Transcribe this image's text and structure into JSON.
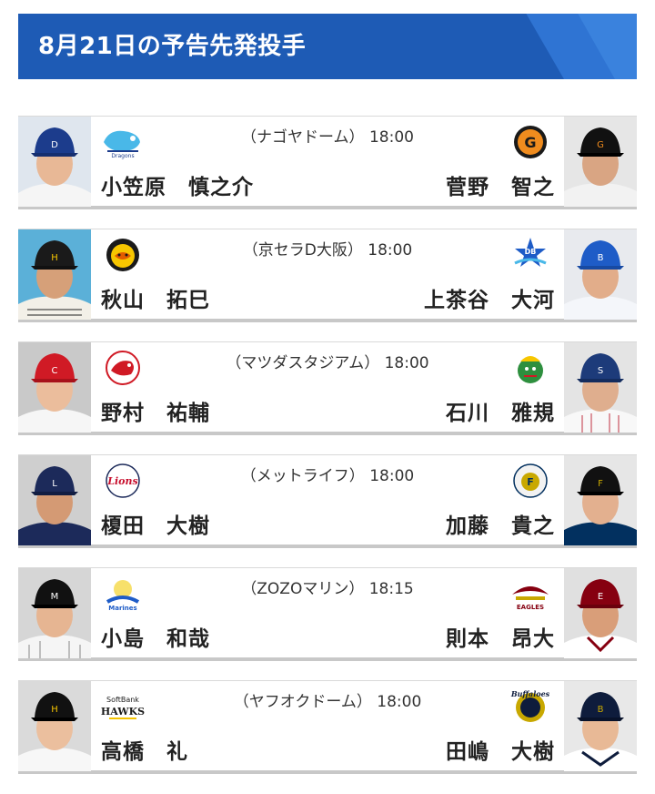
{
  "page_title": "8月21日の予告先発投手",
  "games": [
    {
      "venue": "（ナゴヤドーム）",
      "time": "18:00",
      "home_pitcher": "小笠原　慎之介",
      "away_pitcher": "菅野　智之",
      "home_team_logo": "dragons-logo",
      "away_team_logo": "giants-logo",
      "colors": {
        "home": "#1c3c8c",
        "away": "#f08c1e"
      }
    },
    {
      "venue": "（京セラD大阪）",
      "time": "18:00",
      "home_pitcher": "秋山　拓巳",
      "away_pitcher": "上茶谷　大河",
      "home_team_logo": "tigers-logo",
      "away_team_logo": "baystars-logo",
      "colors": {
        "home": "#f7c600",
        "away": "#1e5cc7"
      }
    },
    {
      "venue": "（マツダスタジアム）",
      "time": "18:00",
      "home_pitcher": "野村　祐輔",
      "away_pitcher": "石川　雅規",
      "home_team_logo": "carp-logo",
      "away_team_logo": "swallows-logo",
      "colors": {
        "home": "#d01a25",
        "away": "#1d3b7a"
      }
    },
    {
      "venue": "（メットライフ）",
      "time": "18:00",
      "home_pitcher": "榎田　大樹",
      "away_pitcher": "加藤　貴之",
      "home_team_logo": "lions-logo",
      "away_team_logo": "fighters-logo",
      "colors": {
        "home": "#1c2a5a",
        "away": "#02305f"
      }
    },
    {
      "venue": "（ZOZOマリン）",
      "time": "18:15",
      "home_pitcher": "小島　和哉",
      "away_pitcher": "則本　昂大",
      "home_team_logo": "marines-logo",
      "away_team_logo": "eagles-logo",
      "colors": {
        "home": "#111111",
        "away": "#860010"
      }
    },
    {
      "venue": "（ヤフオクドーム）",
      "time": "18:00",
      "home_pitcher": "高橋　礼",
      "away_pitcher": "田嶋　大樹",
      "home_team_logo": "hawks-logo",
      "away_team_logo": "buffaloes-logo",
      "colors": {
        "home": "#f4c300",
        "away": "#0e1c3c"
      }
    }
  ],
  "logo_text": {
    "hawks": [
      "SoftBank",
      "HAWKS"
    ],
    "lions": "Lions",
    "buffaloes": "Buffaloes",
    "giants": "G"
  },
  "accent_colors": {
    "header": "#1e5bb5",
    "header_light": "#3a82dd"
  }
}
